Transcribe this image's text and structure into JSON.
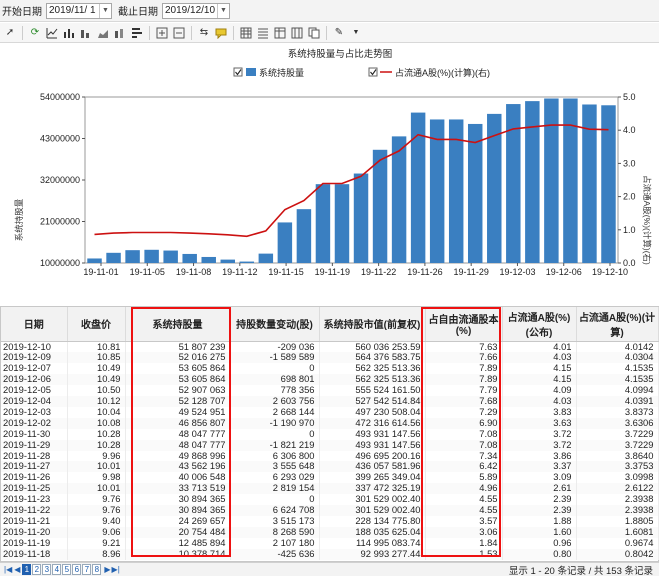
{
  "filters": {
    "start_label": "开始日期",
    "start_value": "2019/11/  1",
    "end_label": "截止日期",
    "end_value": "2019/12/10"
  },
  "chart": {
    "title": "系统持股量与占比走势图",
    "legend_bar": "系统持股量",
    "legend_line": "占流通A股(%)(计算)(右)",
    "ylabel_left": "系统持股量",
    "ylabel_right": "占流通A股(%)(计算)(右)"
  },
  "chart_data": {
    "type": "bar",
    "title": "系统持股量与占比走势图",
    "ylim_left": [
      10000000,
      54000000
    ],
    "ylim_right": [
      0,
      5
    ],
    "left_ticks": [
      "54000000",
      "43000000",
      "32000000",
      "21000000",
      "10000000"
    ],
    "right_ticks": [
      "5.0",
      "4.0",
      "3.0",
      "2.0",
      "1.0",
      "0.0"
    ],
    "x_tick_labels": [
      "19-11-01",
      "19-11-05",
      "19-11-08",
      "19-11-12",
      "19-11-15",
      "19-11-19",
      "19-11-22",
      "19-11-26",
      "19-11-29",
      "19-12-03",
      "19-12-06",
      "19-12-10"
    ],
    "categories": [
      "19-11-01",
      "19-11-04",
      "19-11-05",
      "19-11-06",
      "19-11-07",
      "19-11-08",
      "19-11-11",
      "19-11-12",
      "19-11-13",
      "19-11-14",
      "19-11-15",
      "19-11-18",
      "19-11-19",
      "19-11-20",
      "19-11-21",
      "19-11-22",
      "19-11-25",
      "19-11-26",
      "19-11-27",
      "19-11-28",
      "19-11-29",
      "19-12-02",
      "19-12-03",
      "19-12-04",
      "19-12-05",
      "19-12-06",
      "19-12-09",
      "19-12-10"
    ],
    "series": [
      {
        "name": "系统持股量",
        "type": "bar",
        "axis": "left",
        "color": "#3a7fc1",
        "values": [
          10300000,
          10300000,
          11000000,
          11200000,
          12700000,
          13400000,
          13500000,
          13300000,
          12400000,
          11600000,
          10900000,
          10378714,
          12485894,
          20754484,
          24269657,
          30894365,
          30894365,
          33713519,
          40006548,
          43562196,
          49868996,
          48047777,
          48047777,
          46856807,
          49524951,
          52128707,
          52907063,
          53605864,
          53605864,
          52016275,
          51807239
        ]
      },
      {
        "name": "占流通A股(%)(计算)(右)",
        "type": "line",
        "axis": "right",
        "color": "#cc1111",
        "values": [
          0.78,
          0.78,
          0.8,
          0.86,
          0.9,
          0.92,
          0.92,
          0.92,
          0.9,
          0.88,
          0.85,
          0.8042,
          0.9674,
          1.6081,
          1.8805,
          2.3938,
          2.3938,
          2.6122,
          3.0998,
          3.3753,
          3.864,
          3.7229,
          3.7229,
          3.6306,
          3.8373,
          4.0391,
          4.0994,
          4.1535,
          4.1535,
          4.0304,
          4.0142
        ]
      }
    ]
  },
  "table": {
    "columns": [
      "日期",
      "收盘价",
      "系统持股量",
      "持股数量变动(股)",
      "系统持股市值(前复权)",
      "占自由流通股本(%)",
      "占流通A股(%)(公布)",
      "占流通A股(%)(计算)"
    ],
    "rows": [
      [
        "2019-12-10",
        "10.81",
        "51 807 239",
        "-209 036",
        "560 036 253.59",
        "7.63",
        "4.01",
        "4.0142"
      ],
      [
        "2019-12-09",
        "10.85",
        "52 016 275",
        "-1 589 589",
        "564 376 583.75",
        "7.66",
        "4.03",
        "4.0304"
      ],
      [
        "2019-12-07",
        "10.49",
        "53 605 864",
        "0",
        "562 325 513.36",
        "7.89",
        "4.15",
        "4.1535"
      ],
      [
        "2019-12-06",
        "10.49",
        "53 605 864",
        "698 801",
        "562 325 513.36",
        "7.89",
        "4.15",
        "4.1535"
      ],
      [
        "2019-12-05",
        "10.50",
        "52 907 063",
        "778 356",
        "555 524 161.50",
        "7.79",
        "4.09",
        "4.0994"
      ],
      [
        "2019-12-04",
        "10.12",
        "52 128 707",
        "2 603 756",
        "527 542 514.84",
        "7.68",
        "4.03",
        "4.0391"
      ],
      [
        "2019-12-03",
        "10.04",
        "49 524 951",
        "2 668 144",
        "497 230 508.04",
        "7.29",
        "3.83",
        "3.8373"
      ],
      [
        "2019-12-02",
        "10.08",
        "46 856 807",
        "-1 190 970",
        "472 316 614.56",
        "6.90",
        "3.63",
        "3.6306"
      ],
      [
        "2019-11-30",
        "10.28",
        "48 047 777",
        "0",
        "493 931 147.56",
        "7.08",
        "3.72",
        "3.7229"
      ],
      [
        "2019-11-29",
        "10.28",
        "48 047 777",
        "-1 821 219",
        "493 931 147.56",
        "7.08",
        "3.72",
        "3.7229"
      ],
      [
        "2019-11-28",
        "9.96",
        "49 868 996",
        "6 306 800",
        "496 695 200.16",
        "7.34",
        "3.86",
        "3.8640"
      ],
      [
        "2019-11-27",
        "10.01",
        "43 562 196",
        "3 555 648",
        "436 057 581.96",
        "6.42",
        "3.37",
        "3.3753"
      ],
      [
        "2019-11-26",
        "9.98",
        "40 006 548",
        "6 293 029",
        "399 265 349.04",
        "5.89",
        "3.09",
        "3.0998"
      ],
      [
        "2019-11-25",
        "10.01",
        "33 713 519",
        "2 819 154",
        "337 472 325.19",
        "4.96",
        "2.61",
        "2.6122"
      ],
      [
        "2019-11-23",
        "9.76",
        "30 894 365",
        "0",
        "301 529 002.40",
        "4.55",
        "2.39",
        "2.3938"
      ],
      [
        "2019-11-22",
        "9.76",
        "30 894 365",
        "6 624 708",
        "301 529 002.40",
        "4.55",
        "2.39",
        "2.3938"
      ],
      [
        "2019-11-21",
        "9.40",
        "24 269 657",
        "3 515 173",
        "228 134 775.80",
        "3.57",
        "1.88",
        "1.8805"
      ],
      [
        "2019-11-20",
        "9.06",
        "20 754 484",
        "8 268 590",
        "188 035 625.04",
        "3.06",
        "1.60",
        "1.6081"
      ],
      [
        "2019-11-19",
        "9.21",
        "12 485 894",
        "2 107 180",
        "114 995 083.74",
        "1.84",
        "0.96",
        "0.9674"
      ],
      [
        "2019-11-18",
        "8.96",
        "10 378 714",
        "-425 636",
        "92 993 277.44",
        "1.53",
        "0.80",
        "0.8042"
      ]
    ]
  },
  "pager": {
    "pages": [
      "1",
      "2",
      "3",
      "4",
      "5",
      "6",
      "7",
      "8"
    ],
    "status": "显示 1 - 20 条记录 / 共 153 条记录"
  }
}
